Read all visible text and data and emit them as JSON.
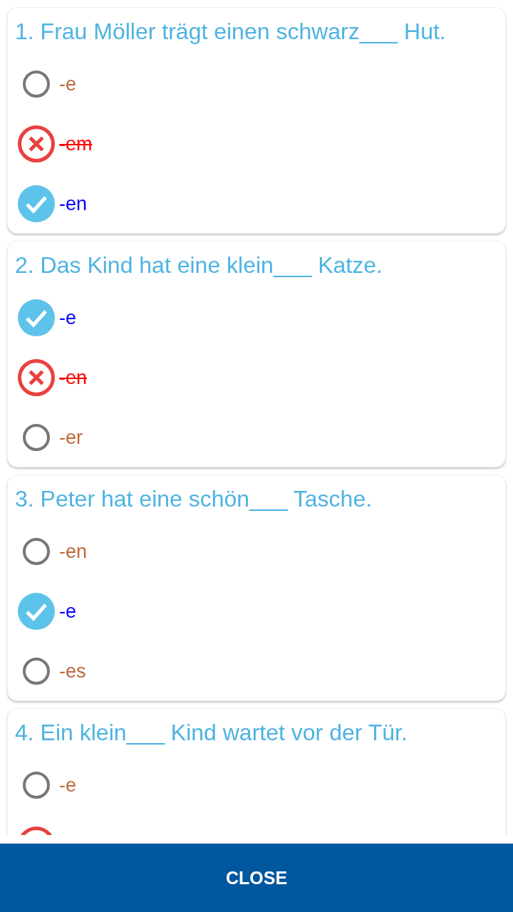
{
  "questions": [
    {
      "text": "1. Frau Möller trägt einen schwarz___ Hut.",
      "options": [
        {
          "label": "-e",
          "kind": "plain"
        },
        {
          "label": "-em",
          "kind": "wrong"
        },
        {
          "label": "-en",
          "kind": "correct"
        }
      ]
    },
    {
      "text": "2. Das Kind hat eine klein___ Katze.",
      "options": [
        {
          "label": "-e",
          "kind": "correct"
        },
        {
          "label": "-en",
          "kind": "wrong"
        },
        {
          "label": "-er",
          "kind": "plain"
        }
      ]
    },
    {
      "text": "3. Peter hat eine schön___ Tasche.",
      "options": [
        {
          "label": "-en",
          "kind": "plain"
        },
        {
          "label": "-e",
          "kind": "correct"
        },
        {
          "label": "-es",
          "kind": "plain"
        }
      ]
    },
    {
      "text": "4. Ein klein___ Kind wartet vor der Tür.",
      "options": [
        {
          "label": "-e",
          "kind": "plain"
        },
        {
          "kind": "wrong"
        }
      ]
    }
  ],
  "close_button": {
    "label": "CLOSE"
  }
}
